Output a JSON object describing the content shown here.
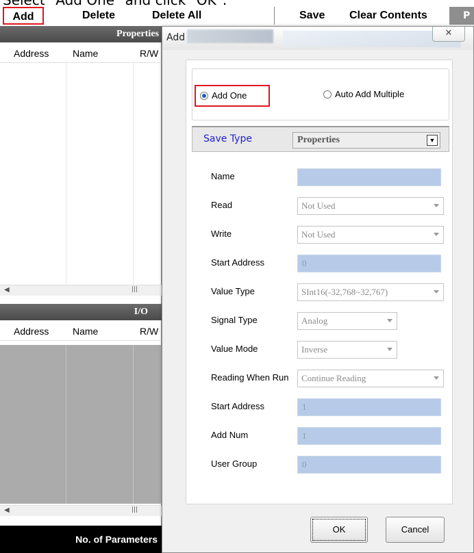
{
  "caption": "Select \"Add One\" and click \"OK\".",
  "toolbar": {
    "add": "Add",
    "delete": "Delete",
    "delete_all": "Delete All",
    "save": "Save",
    "clear_contents": "Clear Contents",
    "cut_label": "P"
  },
  "left_panel": {
    "properties_header": "Properties",
    "columns": [
      "Address",
      "Name",
      "R/W"
    ],
    "io_header": "I/O",
    "io_columns": [
      "Address",
      "Name",
      "R/W"
    ],
    "footer": "No. of Parameters"
  },
  "dialog": {
    "title": "Add",
    "close_glyph": "✕",
    "radio_add_one": "Add One",
    "radio_auto_add": "Auto Add Multiple",
    "save_type_label": "Save Type",
    "save_type_value": "Properties",
    "fields": {
      "name": {
        "label": "Name",
        "value": ""
      },
      "read": {
        "label": "Read",
        "value": "Not Used"
      },
      "write": {
        "label": "Write",
        "value": "Not Used"
      },
      "start_address": {
        "label": "Start Address",
        "value": "0"
      },
      "value_type": {
        "label": "Value Type",
        "value": "SInt16(-32,768~32,767)"
      },
      "signal_type": {
        "label": "Signal Type",
        "value": "Analog"
      },
      "value_mode": {
        "label": "Value Mode",
        "value": "Inverse"
      },
      "reading_when_run": {
        "label": "Reading When Run",
        "value": "Continue Reading"
      },
      "start_address_2": {
        "label": "Start Address",
        "value": "1"
      },
      "add_num": {
        "label": "Add Num",
        "value": "1"
      },
      "user_group": {
        "label": "User Group",
        "value": "0"
      }
    },
    "ok": "OK",
    "cancel": "Cancel"
  },
  "colors": {
    "highlight_red": "#e0161e",
    "input_blue": "#b7cbe8",
    "save_type_blue": "#2222cc"
  }
}
